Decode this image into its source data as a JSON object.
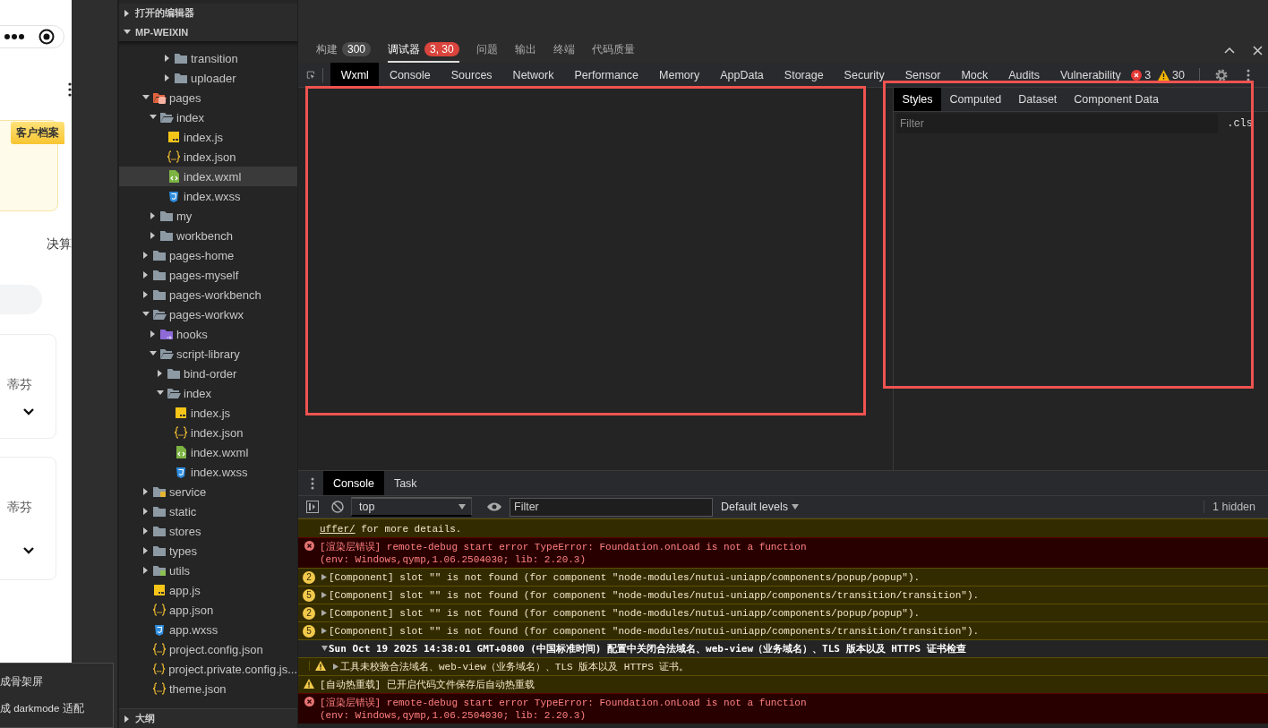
{
  "phone": {
    "tag": "客户档案",
    "tab_fragment": "决算",
    "cards": [
      {
        "name": "蒂芬"
      },
      {
        "name": "蒂芬"
      }
    ],
    "context_menu": [
      "成骨架屏",
      "成 darkmode 适配"
    ]
  },
  "explorer": {
    "sections": [
      {
        "label": "打开的编辑器",
        "expanded": false
      },
      {
        "label": "MP-WEIXIN",
        "expanded": true
      }
    ],
    "continued": [
      {
        "name": "transition",
        "kind": "folder",
        "expanded": false,
        "selected": false
      },
      {
        "name": "uploader",
        "kind": "folder",
        "expanded": false,
        "selected": false
      }
    ],
    "items": [
      {
        "name": "pages",
        "kind": "pages",
        "expanded": true,
        "selected": false,
        "children": [
          {
            "name": "index",
            "kind": "folder",
            "expanded": true,
            "selected": false,
            "children": [
              {
                "name": "index.js",
                "kind": "js",
                "selected": false
              },
              {
                "name": "index.json",
                "kind": "json",
                "selected": false
              },
              {
                "name": "index.wxml",
                "kind": "wxml",
                "selected": true
              },
              {
                "name": "index.wxss",
                "kind": "wxss",
                "selected": false
              }
            ]
          },
          {
            "name": "my",
            "kind": "folder",
            "expanded": false,
            "selected": false
          },
          {
            "name": "workbench",
            "kind": "folder",
            "expanded": false,
            "selected": false
          }
        ]
      },
      {
        "name": "pages-home",
        "kind": "folder",
        "expanded": false,
        "selected": false
      },
      {
        "name": "pages-myself",
        "kind": "folder",
        "expanded": false,
        "selected": false
      },
      {
        "name": "pages-workbench",
        "kind": "folder",
        "expanded": false,
        "selected": false
      },
      {
        "name": "pages-workwx",
        "kind": "folder",
        "expanded": true,
        "selected": false,
        "children": [
          {
            "name": "hooks",
            "kind": "hooks",
            "expanded": false,
            "selected": false
          },
          {
            "name": "script-library",
            "kind": "folder",
            "expanded": true,
            "selected": false,
            "children": [
              {
                "name": "bind-order",
                "kind": "folder",
                "expanded": false,
                "selected": false
              },
              {
                "name": "index",
                "kind": "folder",
                "expanded": true,
                "selected": false,
                "children": [
                  {
                    "name": "index.js",
                    "kind": "js",
                    "selected": false
                  },
                  {
                    "name": "index.json",
                    "kind": "json",
                    "selected": false
                  },
                  {
                    "name": "index.wxml",
                    "kind": "wxml",
                    "selected": false
                  },
                  {
                    "name": "index.wxss",
                    "kind": "wxss",
                    "selected": false
                  }
                ]
              }
            ]
          }
        ]
      },
      {
        "name": "service",
        "kind": "service",
        "expanded": false,
        "selected": false
      },
      {
        "name": "static",
        "kind": "folder",
        "expanded": false,
        "selected": false
      },
      {
        "name": "stores",
        "kind": "folder",
        "expanded": false,
        "selected": false
      },
      {
        "name": "types",
        "kind": "folder",
        "expanded": false,
        "selected": false
      },
      {
        "name": "utils",
        "kind": "utils",
        "expanded": false,
        "selected": false
      },
      {
        "name": "app.js",
        "kind": "js",
        "selected": false
      },
      {
        "name": "app.json",
        "kind": "json",
        "selected": false
      },
      {
        "name": "app.wxss",
        "kind": "wxss",
        "selected": false
      },
      {
        "name": "project.config.json",
        "kind": "json",
        "selected": false
      },
      {
        "name": "project.private.config.js...",
        "kind": "json",
        "selected": false
      },
      {
        "name": "theme.json",
        "kind": "json",
        "selected": false
      }
    ],
    "bottom_sections": [
      {
        "label": "大纲",
        "expanded": false
      }
    ]
  },
  "devtools": {
    "panel_tabs": [
      {
        "label": "构建",
        "badge": {
          "text": "300",
          "kind": "neutral"
        },
        "selected": false
      },
      {
        "label": "调试器",
        "badge": {
          "text": "3, 30",
          "kind": "alert"
        },
        "selected": true
      },
      {
        "label": "问题",
        "selected": false
      },
      {
        "label": "输出",
        "selected": false
      },
      {
        "label": "终端",
        "selected": false
      },
      {
        "label": "代码质量",
        "selected": false
      }
    ],
    "tool_tabs": [
      {
        "label": "Wxml",
        "selected": true
      },
      {
        "label": "Console",
        "selected": false
      },
      {
        "label": "Sources",
        "selected": false
      },
      {
        "label": "Network",
        "selected": false
      },
      {
        "label": "Performance",
        "selected": false
      },
      {
        "label": "Memory",
        "selected": false
      },
      {
        "label": "AppData",
        "selected": false
      },
      {
        "label": "Storage",
        "selected": false
      },
      {
        "label": "Security",
        "selected": false
      },
      {
        "label": "Sensor",
        "selected": false
      },
      {
        "label": "Mock",
        "selected": false
      },
      {
        "label": "Audits",
        "selected": false
      },
      {
        "label": "Vulnerability",
        "selected": false
      }
    ],
    "issue_counts": {
      "errors": "3",
      "warnings": "30"
    },
    "styles_pane": {
      "tabs": [
        {
          "label": "Styles",
          "selected": true
        },
        {
          "label": "Computed",
          "selected": false
        },
        {
          "label": "Dataset",
          "selected": false
        },
        {
          "label": "Component Data",
          "selected": false
        }
      ],
      "filter_placeholder": "Filter",
      "cls_toggle": ".cls"
    },
    "drawer": {
      "tabs": [
        {
          "label": "Console",
          "selected": true
        },
        {
          "label": "Task",
          "selected": false
        }
      ],
      "context": "top",
      "filter_placeholder": "Filter",
      "levels": "Default levels",
      "hidden_count": "1 hidden",
      "messages": [
        {
          "kind": "warn-continued",
          "link": "uffer/",
          "text": " for more details."
        },
        {
          "kind": "error",
          "text": "[渲染层错误] remote-debug start error TypeError: Foundation.onLoad is not a function",
          "detail": "(env: Windows,qymp,1.06.2504030; lib: 2.20.3)"
        },
        {
          "kind": "warn",
          "count": "2",
          "expanded": false,
          "text": "[Component] slot \"\" is not found (for component \"node-modules/nutui-uniapp/components/popup/popup\")."
        },
        {
          "kind": "warn",
          "count": "5",
          "expanded": false,
          "text": "[Component] slot \"\" is not found (for component \"node-modules/nutui-uniapp/components/transition/transition\")."
        },
        {
          "kind": "warn",
          "count": "2",
          "expanded": false,
          "text": "[Component] slot \"\" is not found (for component \"node-modules/nutui-uniapp/components/popup/popup\")."
        },
        {
          "kind": "warn",
          "count": "5",
          "expanded": false,
          "text": "[Component] slot \"\" is not found (for component \"node-modules/nutui-uniapp/components/transition/transition\")."
        },
        {
          "kind": "group",
          "expanded": true,
          "text": "Sun Oct 19 2025 14:38:01 GMT+0800 (中国标准时间) 配置中关闭合法域名、web-view（业务域名）、TLS 版本以及 HTTPS 证书检查"
        },
        {
          "kind": "group-warn",
          "expanded": false,
          "text": "工具未校验合法域名、web-view（业务域名）、TLS 版本以及 HTTPS 证书。"
        },
        {
          "kind": "warn",
          "text": "[自动热重载] 已开启代码文件保存后自动热重载"
        },
        {
          "kind": "error",
          "text": "[渲染层错误] remote-debug start error TypeError: Foundation.onLoad is not a function",
          "detail": "(env: Windows,qymp,1.06.2504030; lib: 2.20.3)"
        }
      ]
    }
  }
}
